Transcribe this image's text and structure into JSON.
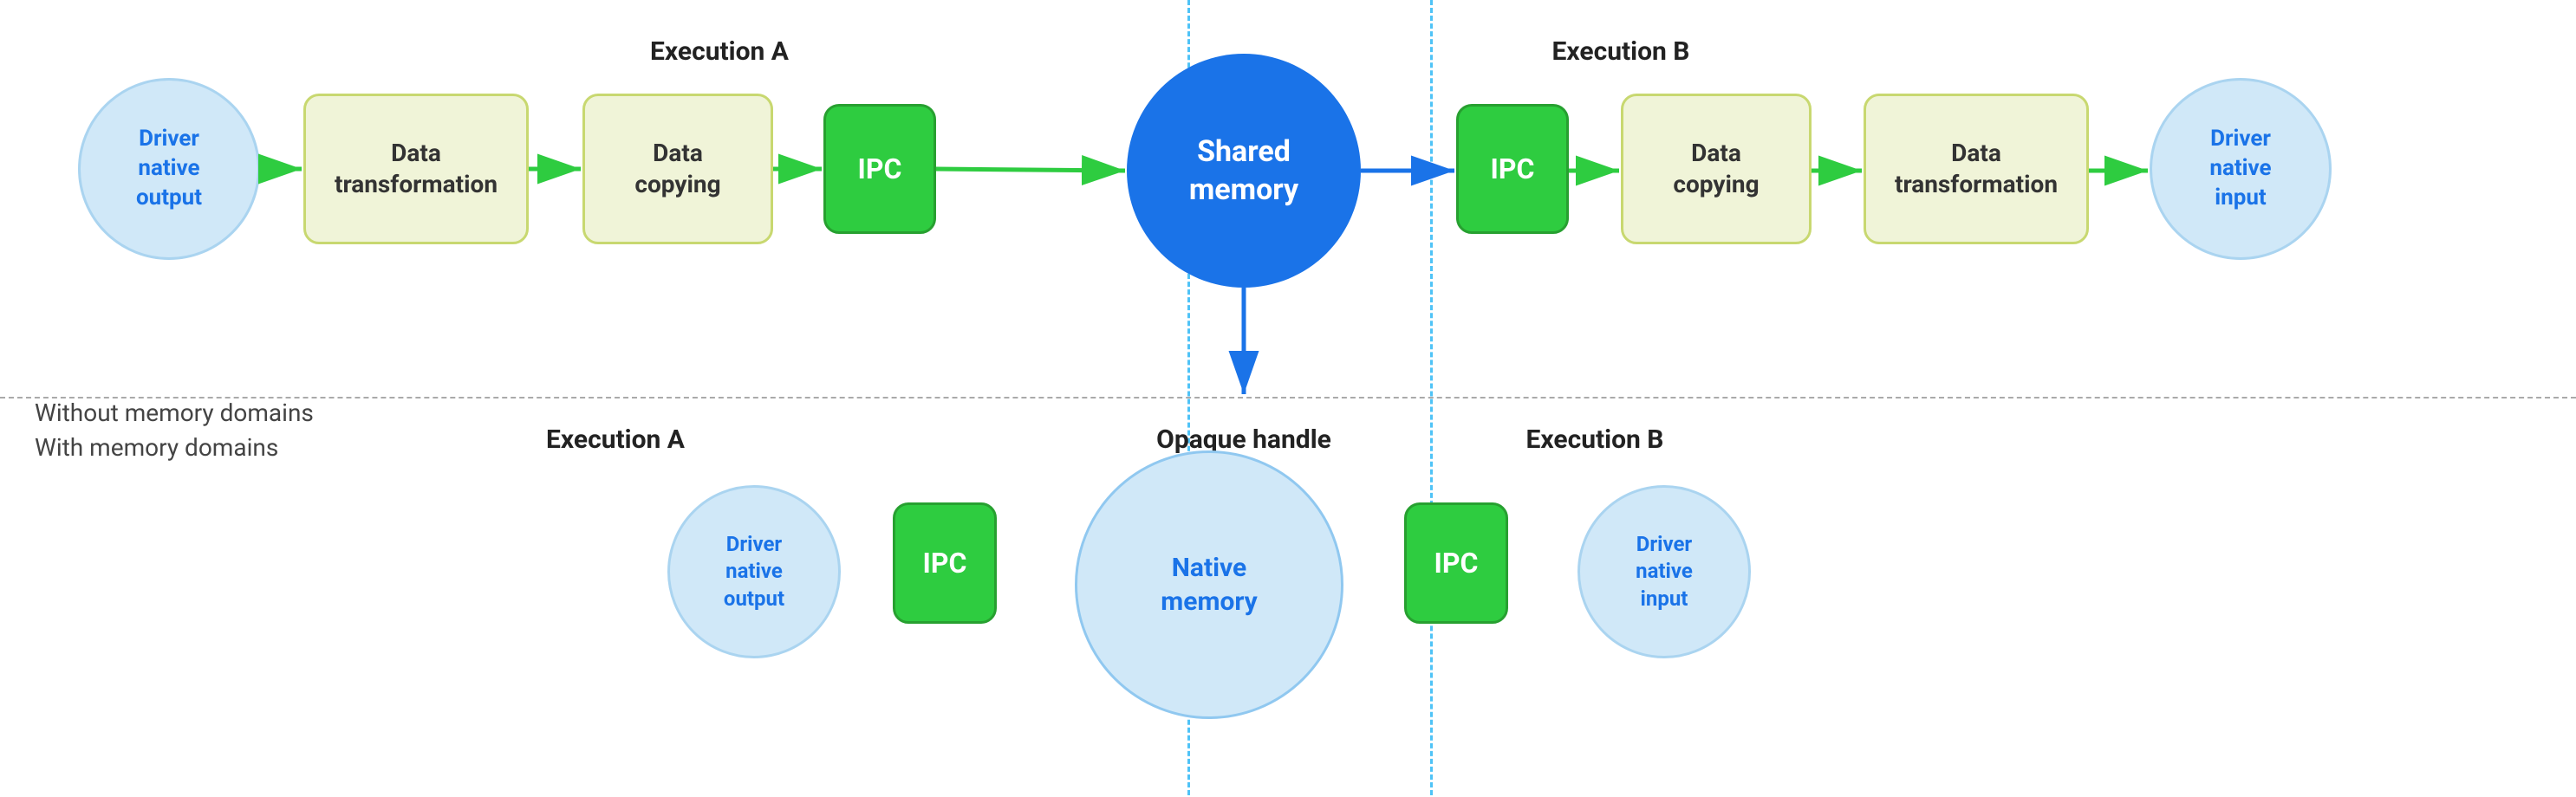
{
  "sections": {
    "without_label": "Without memory domains",
    "with_label": "With memory domains"
  },
  "top_row": {
    "exec_a_label": "Execution A",
    "exec_b_label": "Execution B",
    "nodes": [
      {
        "id": "driver-native-output-top",
        "label": "Driver\nnative\noutput",
        "type": "circle-light-blue"
      },
      {
        "id": "data-transform-1",
        "label": "Data\ntransformation",
        "type": "rect-yellow"
      },
      {
        "id": "data-copying-1",
        "label": "Data\ncopying",
        "type": "rect-yellow"
      },
      {
        "id": "ipc-1",
        "label": "IPC",
        "type": "rect-green"
      },
      {
        "id": "shared-memory",
        "label": "Shared\nmemory",
        "type": "circle-blue-large"
      },
      {
        "id": "ipc-2",
        "label": "IPC",
        "type": "rect-green"
      },
      {
        "id": "data-copying-2",
        "label": "Data\ncopying",
        "type": "rect-yellow"
      },
      {
        "id": "data-transform-2",
        "label": "Data\ntransformation",
        "type": "rect-yellow"
      },
      {
        "id": "driver-native-input-top",
        "label": "Driver\nnative\ninput",
        "type": "circle-light-blue"
      }
    ]
  },
  "bottom_row": {
    "exec_a_label": "Execution A",
    "exec_b_label": "Execution B",
    "opaque_label": "Opaque handle",
    "nodes": [
      {
        "id": "driver-native-output-bottom",
        "label": "Driver\nnative\noutput",
        "type": "circle-light-blue"
      },
      {
        "id": "ipc-3",
        "label": "IPC",
        "type": "rect-green"
      },
      {
        "id": "native-memory",
        "label": "Native\nmemory",
        "type": "circle-native-memory"
      },
      {
        "id": "ipc-4",
        "label": "IPC",
        "type": "rect-green"
      },
      {
        "id": "driver-native-input-bottom",
        "label": "Driver\nnative\ninput",
        "type": "circle-light-blue"
      }
    ]
  },
  "colors": {
    "accent_blue": "#1a73e8",
    "light_blue_bg": "#d0e8f8",
    "yellow_bg": "#f0f4d8",
    "green_bg": "#2ecc40",
    "arrow_green": "#2ecc40",
    "arrow_blue": "#1a73e8",
    "dotted_line": "#4fc3f7"
  }
}
